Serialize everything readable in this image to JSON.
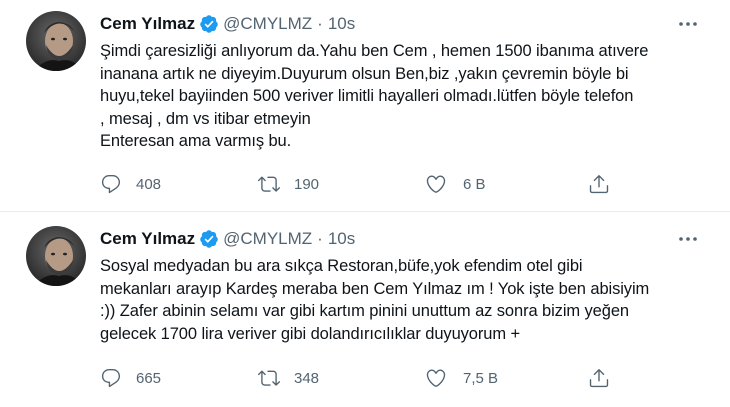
{
  "tweets": [
    {
      "author_name": "Cem Yılmaz",
      "handle": "@CMYLMZ",
      "separator": "·",
      "time": "10s",
      "body_lines": [
        "Şimdi çaresizliği anlıyorum da.Yahu ben Cem , hemen 1500 ibanıma atıvere",
        "inanana artık ne diyeyim.Duyurum olsun Ben,biz ,yakın çevremin böyle bi",
        "huyu,tekel bayiinden 500 veriver limitli hayalleri olmadı.lütfen böyle telefon",
        ", mesaj , dm  vs itibar etmeyin",
        "Enteresan ama varmış bu."
      ],
      "replies": "408",
      "retweets": "190",
      "likes": "6 B"
    },
    {
      "author_name": "Cem Yılmaz",
      "handle": "@CMYLMZ",
      "separator": "·",
      "time": "10s",
      "body_lines": [
        "Sosyal medyadan bu ara sıkça Restoran,büfe,yok efendim otel gibi",
        "mekanları arayıp Kardeş meraba ben Cem Yılmaz ım ! Yok işte ben abisiyim",
        ":)) Zafer abinin selamı var gibi kartım pinini unuttum az sonra bizim yeğen",
        "gelecek 1700 lira veriver gibi dolandırıcılıklar  duyuyorum +"
      ],
      "replies": "665",
      "retweets": "348",
      "likes": "7,5 B"
    }
  ],
  "icons": {
    "verified": "verified-badge-icon",
    "more": "more-options-icon",
    "reply": "reply-icon",
    "retweet": "retweet-icon",
    "like": "like-icon",
    "share": "share-icon"
  },
  "colors": {
    "verified_blue": "#1d9bf0",
    "text": "#0f1419",
    "secondary": "#536471",
    "divider": "#e6ecf0"
  }
}
